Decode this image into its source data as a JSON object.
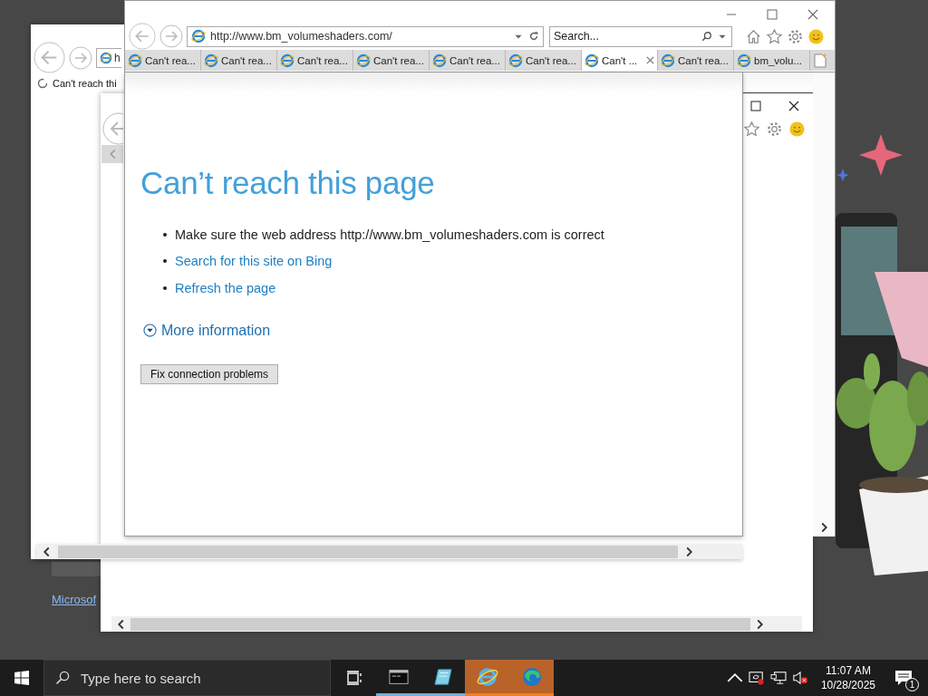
{
  "back_window": {
    "address": "h",
    "tab_title": "Can't reach thi",
    "link": "Microsof"
  },
  "browser": {
    "address": "http://www.bm_volumeshaders.com/",
    "search_placeholder": "Search...",
    "tabs": [
      {
        "title": "Can't rea...",
        "selected": false
      },
      {
        "title": "Can't rea...",
        "selected": false
      },
      {
        "title": "Can't rea...",
        "selected": false
      },
      {
        "title": "Can't rea...",
        "selected": false
      },
      {
        "title": "Can't rea...",
        "selected": false
      },
      {
        "title": "Can't rea...",
        "selected": false
      },
      {
        "title": "Can't ...",
        "selected": true
      },
      {
        "title": "Can't rea...",
        "selected": false
      },
      {
        "title": "bm_volu...",
        "selected": false
      }
    ],
    "page": {
      "heading": "Can’t reach this page",
      "bullets": [
        {
          "kind": "text",
          "text": "Make sure the web address http://www.bm_volumeshaders.com is correct"
        },
        {
          "kind": "link",
          "text": "Search for this site on Bing"
        },
        {
          "kind": "link",
          "text": "Refresh the page"
        }
      ],
      "more_info": {
        "label": "More information",
        "expanded": false
      },
      "button": "Fix connection problems"
    }
  },
  "taskbar": {
    "search_placeholder": "Type here to search",
    "apps": [
      {
        "kind": "taskview",
        "running": false,
        "flashing": false
      },
      {
        "kind": "terminal",
        "running": true,
        "flashing": false
      },
      {
        "kind": "notepad",
        "running": true,
        "flashing": false
      },
      {
        "kind": "ie",
        "running": true,
        "flashing": true
      },
      {
        "kind": "edge",
        "running": true,
        "flashing": true
      }
    ],
    "time": "11:07 AM",
    "date": "10/28/2025",
    "notification_count": "1"
  }
}
